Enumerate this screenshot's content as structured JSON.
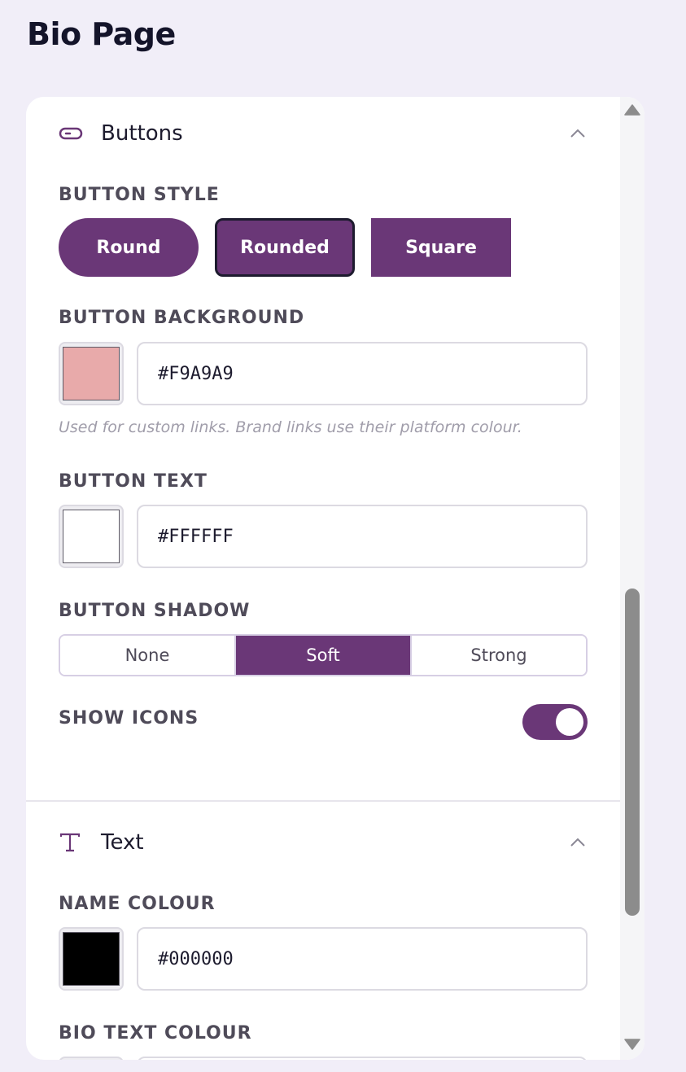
{
  "page": {
    "title": "Bio Page"
  },
  "sections": {
    "buttons": {
      "title": "Buttons",
      "icon": "pill-button-icon",
      "style_label": "BUTTON STYLE",
      "styles": [
        "Round",
        "Rounded",
        "Square"
      ],
      "selected_style": "Rounded",
      "background_label": "BUTTON BACKGROUND",
      "background_value": "#F9A9A9",
      "background_swatch": "#E8AAAA",
      "background_hint": "Used for custom links. Brand links use their platform colour.",
      "text_label": "BUTTON TEXT",
      "text_value": "#FFFFFF",
      "shadow_label": "BUTTON SHADOW",
      "shadow_options": [
        "None",
        "Soft",
        "Strong"
      ],
      "selected_shadow": "Soft",
      "icons_label": "SHOW ICONS",
      "icons_enabled": true
    },
    "text": {
      "title": "Text",
      "icon": "text-type-icon",
      "name_label": "NAME COLOUR",
      "name_value": "#000000",
      "bio_label": "BIO TEXT COLOUR"
    }
  },
  "colors": {
    "accent": "#6A3777",
    "page_background": "#F1EEF8",
    "selected_border": "#1D1B2E"
  }
}
